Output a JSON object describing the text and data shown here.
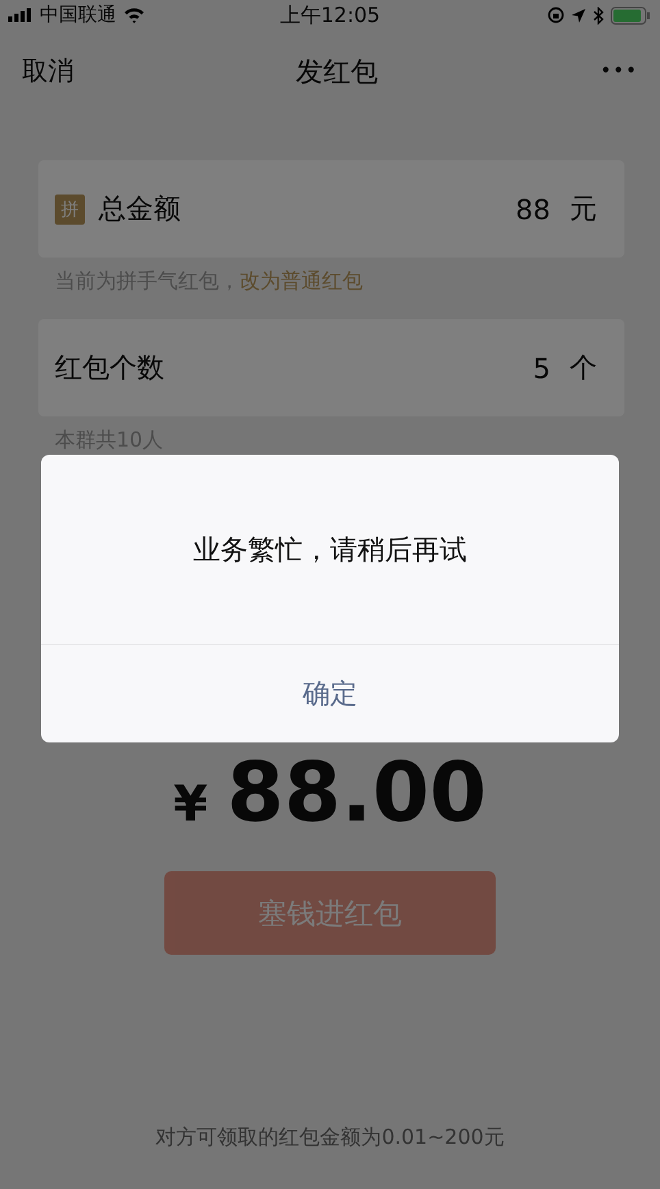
{
  "status_bar": {
    "carrier": "中国联通",
    "time": "上午12:05"
  },
  "nav": {
    "cancel": "取消",
    "title": "发红包",
    "more": "•••"
  },
  "amount_card": {
    "badge": "拼",
    "label": "总金额",
    "value": "88",
    "unit": "元"
  },
  "amount_hint": {
    "text": "当前为拼手气红包，",
    "link": "改为普通红包"
  },
  "count_card": {
    "label": "红包个数",
    "value": "5",
    "unit": "个"
  },
  "count_hint": "本群共10人",
  "total": {
    "currency": "¥",
    "amount": "88.00"
  },
  "submit_button": {
    "label": "塞钱进红包",
    "disabled": true
  },
  "footer": "对方可领取的红包金额为0.01~200元",
  "dialog": {
    "message": "业务繁忙，请稍后再试",
    "button": "确定"
  }
}
